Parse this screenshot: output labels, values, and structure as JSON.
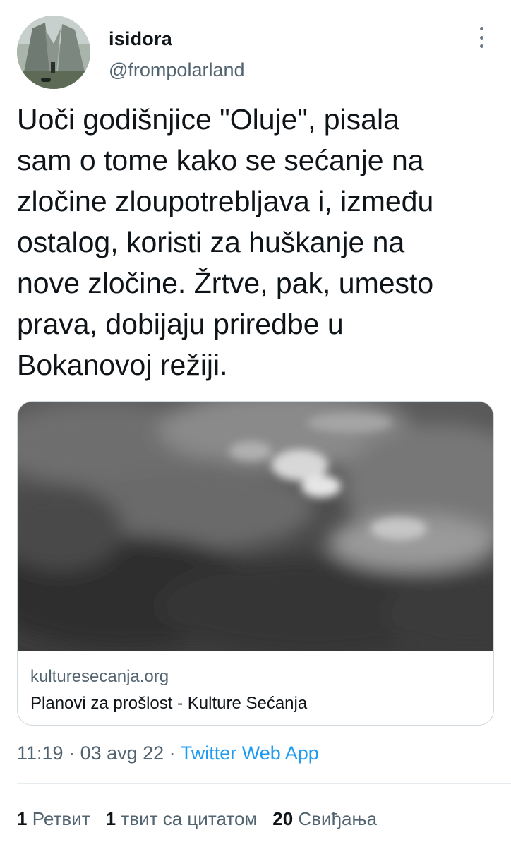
{
  "user": {
    "display_name": "isidora",
    "handle": "@frompolarland"
  },
  "tweet": {
    "text": "Uoči godišnjice \"Oluje\", pisala\nsam o tome kako se sećanje na\nzločine zloupotrebljava i, između\nostalog, koristi za huškanje na\nnove zločine. Žrtve, pak, umesto\nprava, dobijaju priredbe u\nBokanovoj režiji."
  },
  "card": {
    "domain": "kulturesecanja.org",
    "title": "Planovi za prošlost - Kulture Sećanja"
  },
  "meta": {
    "time": "11:19",
    "separator": " · ",
    "date": "03 avg 22",
    "app": "Twitter Web App"
  },
  "stats": {
    "retweets_count": "1",
    "retweets_label": "Ретвит",
    "quotes_count": "1",
    "quotes_label": "твит са цитатом",
    "likes_count": "20",
    "likes_label": "Свиђања"
  },
  "colors": {
    "accent": "#1d9bf0",
    "secondary_text": "#536471",
    "border": "#cfd9de"
  },
  "icons": {
    "more": "more-dots-icon"
  }
}
